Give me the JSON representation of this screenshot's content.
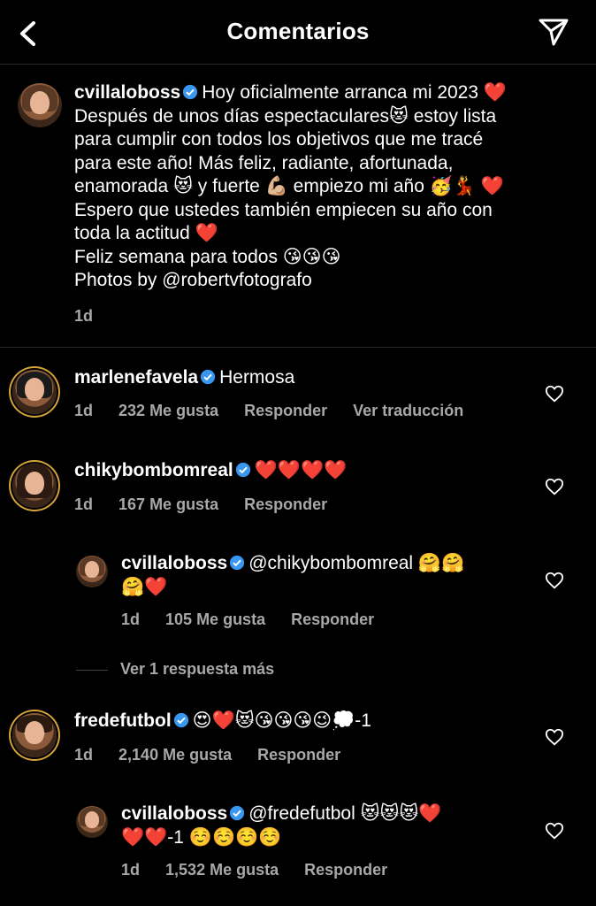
{
  "header": {
    "title": "Comentarios",
    "back_icon": "chevron-left-icon",
    "share_icon": "send-icon"
  },
  "caption": {
    "username": "cvillaloboss",
    "line1": "Hoy oficialmente arranca mi 2023 ❤️",
    "line2": "Después de unos días espectaculares😻 estoy lista",
    "line3": "para cumplir con todos los objetivos que me tracé",
    "line4": "para este año! Más feliz, radiante, afortunada,",
    "line5": "enamorada 😻 y fuerte 💪🏼 empiezo mi año 🥳💃 ❤️",
    "line6": "Espero que ustedes también empiecen su año con",
    "line7": "toda la actitud ❤️",
    "line8": "Feliz semana para todos 😘😘😘",
    "line9": "Photos by @robertvfotografo",
    "time": "1d"
  },
  "comments": [
    {
      "username": "marlenefavela",
      "text": "Hermosa",
      "time": "1d",
      "likes": "232 Me gusta",
      "reply": "Responder",
      "translate": "Ver traducción"
    },
    {
      "username": "chikybombomreal",
      "text": "❤️❤️❤️❤️",
      "time": "1d",
      "likes": "167 Me gusta",
      "reply": "Responder"
    },
    {
      "username": "cvillaloboss",
      "text1": "@chikybombomreal 🤗🤗",
      "text2": "🤗❤️",
      "time": "1d",
      "likes": "105 Me gusta",
      "reply": "Responder"
    },
    {
      "username": "fredefutbol",
      "text": "😍❤️😻😘😘😘😉💭-1",
      "time": "1d",
      "likes": "2,140 Me gusta",
      "reply": "Responder"
    },
    {
      "username": "cvillaloboss",
      "text1": "@fredefutbol 😻😻😻❤️",
      "text2": "❤️❤️-1 ☺️☺️☺️☺️",
      "time": "1d",
      "likes": "1,532 Me gusta",
      "reply": "Responder"
    }
  ],
  "more_replies": "Ver 1 respuesta más",
  "colors": {
    "background": "#000000",
    "text": "#ffffff",
    "muted": "#a8a8a8",
    "verified": "#3897f0"
  }
}
